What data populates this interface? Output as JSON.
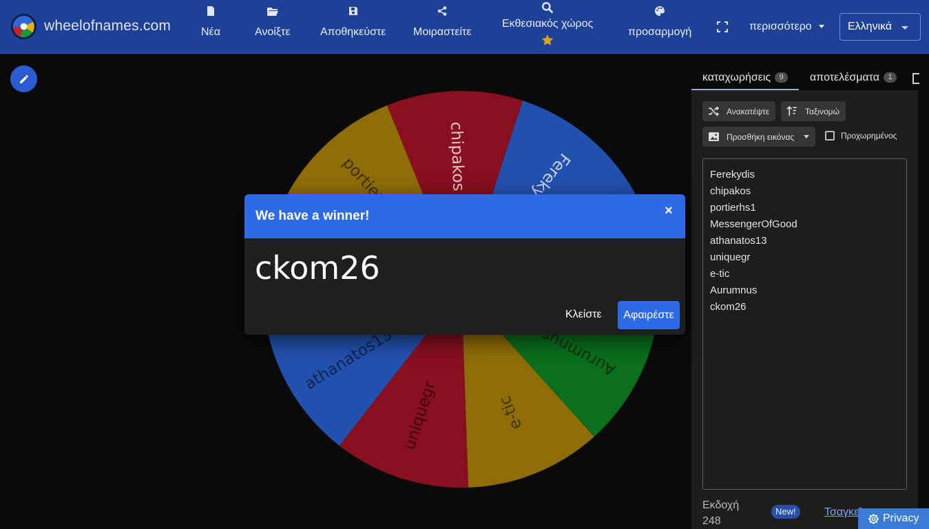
{
  "app": {
    "brand": "wheelofnames.com"
  },
  "nav": {
    "new": "Νέα",
    "open": "Ανοίξτε",
    "save": "Αποθηκεύστε",
    "share": "Μοιραστείτε",
    "gallery": "Εκθεσιακός χώρος",
    "customize": "προσαρμογή",
    "more": "περισσότερο",
    "language": "Ελληνικά"
  },
  "tabs": {
    "entries_label": "καταχωρήσεις",
    "entries_count": "9",
    "results_label": "αποτελέσματα",
    "results_count": "1"
  },
  "toolbar": {
    "shuffle": "Ανακατέψτε",
    "sort": "Ταξινομώ",
    "add_image": "Προσθήκη εικόνας",
    "advanced": "Προχωρημένος"
  },
  "entries": [
    "Ferekydis",
    "chipakos",
    "portierhs1",
    "MessengerOfGood",
    "athanatos13",
    "uniquegr",
    "e-tic",
    "Aurumnus",
    "ckom26"
  ],
  "wheel": {
    "colors": {
      "blue": "#2250ae",
      "red": "#880f1d",
      "yellow": "#8e6c08",
      "green": "#0a6e1d"
    }
  },
  "footer": {
    "version_label": "Εκδοχή",
    "version_number": "248",
    "new_badge": "New!",
    "changelog": "Τσαγκελόγκ",
    "privacy": "Privacy"
  },
  "dialog": {
    "title": "We have a winner!",
    "close_x": "×",
    "winner": "ckom26",
    "close_button": "Κλείστε",
    "remove_button": "Αφαιρέστε"
  }
}
